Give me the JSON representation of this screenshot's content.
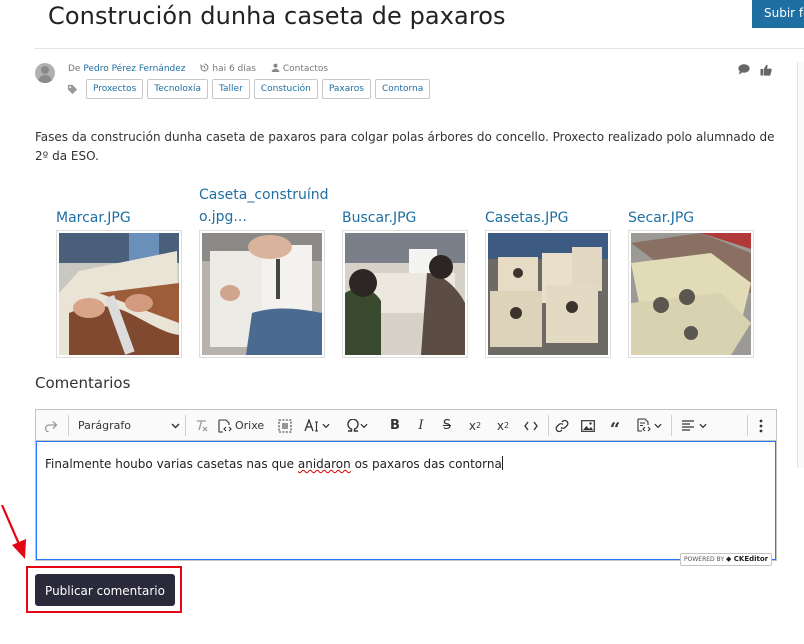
{
  "header": {
    "title": "Construción dunha caseta de paxaros",
    "upload_label": "Subir fo"
  },
  "post": {
    "by_prefix": "De",
    "author": "Pedro Pérez Fernández",
    "time": "hai 6 días",
    "visibility": "Contactos",
    "tags": [
      "Proxectos",
      "Tecnoloxía",
      "Taller",
      "Constución",
      "Paxaros",
      "Contorna"
    ],
    "description": "Fases da construción dunha caseta de paxaros para colgar polas árbores do concello. Proxecto realizado polo alumnado de 2º da ESO."
  },
  "gallery": [
    {
      "name": "Marcar.JPG"
    },
    {
      "name": "Caseta_construíndo.jpg..."
    },
    {
      "name": "Buscar.JPG"
    },
    {
      "name": "Casetas.JPG"
    },
    {
      "name": "Secar.JPG"
    }
  ],
  "comments": {
    "title": "Comentarios",
    "toolbar": {
      "paragraph": "Parágrafo",
      "source": "Orixe"
    },
    "text_before": "Finalmente houbo varias casetas nas que ",
    "text_misspelled": "anidaron",
    "text_after": " os paxaros das contorna",
    "powered_by": "POWERED BY",
    "editor_brand": "CKEditor",
    "publish_label": "Publicar comentario"
  },
  "colors": {
    "link": "#1f6fa3",
    "primary_button": "#2a2a3a",
    "highlight": "#e30613",
    "upload_button": "#1f6fa3"
  }
}
